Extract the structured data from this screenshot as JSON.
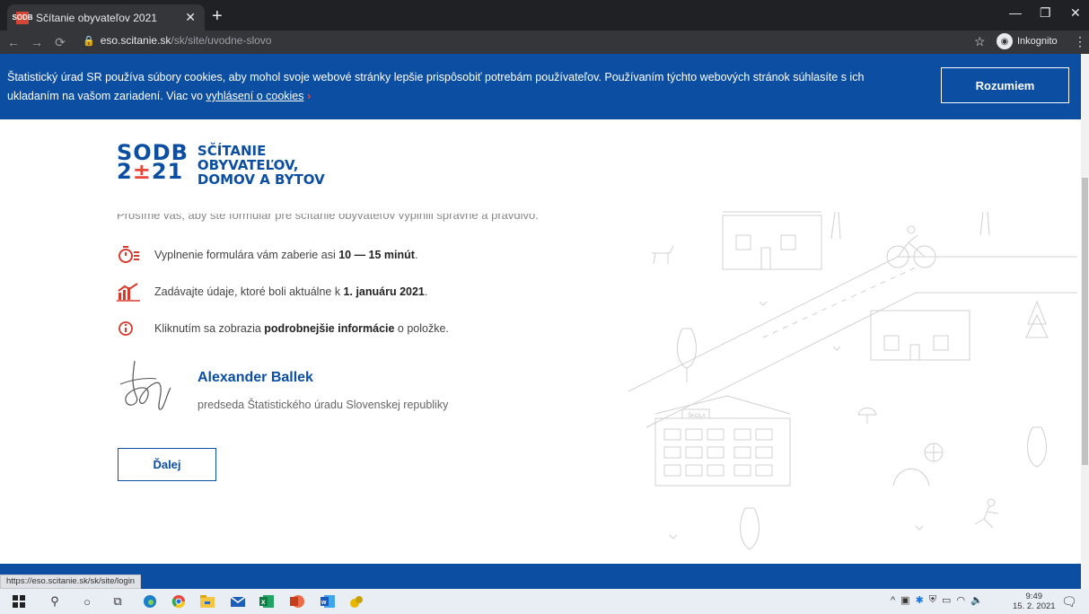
{
  "browser": {
    "tab_title": "Sčítanie obyvateľov 2021",
    "tab_favicon_text": "SODB",
    "url_host": "eso.scitanie.sk",
    "url_path": "/sk/site/uvodne-slovo",
    "incognito_label": "Inkognito",
    "status_url": "https://eso.scitanie.sk/sk/site/login"
  },
  "cookie_banner": {
    "text_line": "Štatistický úrad SR používa súbory cookies, aby mohol svoje webové stránky lepšie prispôsobiť potrebám používateľov. Používaním týchto webových stránok súhlasíte s ich ukladaním na vašom zariadení. Viac vo ",
    "link_text": "vyhlásení o cookies",
    "button_label": "Rozumiem"
  },
  "logo": {
    "mark_top": "SODB",
    "mark_bottom_a": "2",
    "mark_bottom_plusminus": "±",
    "mark_bottom_b": "21",
    "line1": "SČÍTANIE",
    "line2": "OBYVATEĽOV,",
    "line3": "DOMOV A BYTOV"
  },
  "content": {
    "intro": "Prosíme vás, aby ste formulár pre sčítanie obyvateľov vyplnili správne a pravdivo.",
    "items": [
      {
        "icon": "stopwatch-icon",
        "text_a": "Vyplnenie formulára vám zaberie asi ",
        "bold": "10 — 15 minút",
        "text_b": "."
      },
      {
        "icon": "chart-calendar-icon",
        "text_a": "Zadávajte údaje, ktoré boli aktuálne k ",
        "bold": "1. januáru 2021",
        "text_b": "."
      },
      {
        "icon": "info-icon",
        "text_a": "Kliknutím sa zobrazia ",
        "bold": "podrobnejšie informácie",
        "text_b": " o položke."
      }
    ],
    "author_name": "Alexander Ballek",
    "author_role": "predseda Štatistického úradu Slovenskej republiky",
    "next_button": "Ďalej"
  },
  "illustration": {
    "school_sign": "ŠKOLA"
  },
  "taskbar": {
    "time": "9:49",
    "date": "15. 2. 2021"
  },
  "colors": {
    "brand_blue": "#0b4ea2",
    "accent_red": "#e8473b"
  }
}
